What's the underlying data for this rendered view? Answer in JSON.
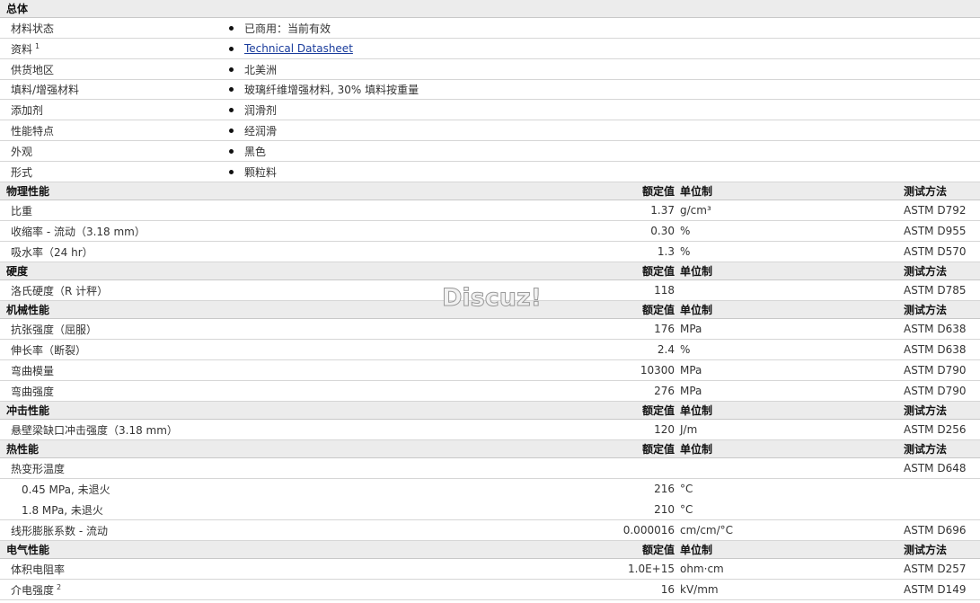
{
  "columns": {
    "nominal": "额定值",
    "unit": "单位制",
    "method": "测试方法"
  },
  "general": {
    "title": "总体",
    "rows": [
      {
        "label": "材料状态",
        "value": "已商用：当前有效"
      },
      {
        "label": "资料",
        "sup": "1",
        "value": "Technical Datasheet"
      },
      {
        "label": "供货地区",
        "value": "北美洲"
      },
      {
        "label": "填料/增强材料",
        "value": "玻璃纤维增强材料, 30% 填料按重量"
      },
      {
        "label": "添加剂",
        "value": "润滑剂"
      },
      {
        "label": "性能特点",
        "value": "经润滑"
      },
      {
        "label": "外观",
        "value": "黑色"
      },
      {
        "label": "形式",
        "value": "颗粒料"
      }
    ]
  },
  "physical": {
    "title": "物理性能",
    "rows": [
      {
        "label": "比重",
        "value": "1.37",
        "unit": "g/cm³",
        "method": "ASTM D792"
      },
      {
        "label": "收缩率  - 流动（3.18 mm）",
        "value": "0.30",
        "unit": "%",
        "method": "ASTM D955"
      },
      {
        "label": "吸水率（24 hr）",
        "value": "1.3",
        "unit": "%",
        "method": "ASTM D570"
      }
    ]
  },
  "hardness": {
    "title": "硬度",
    "rows": [
      {
        "label": "洛氏硬度（R 计秤）",
        "value": "118",
        "unit": "",
        "method": "ASTM D785"
      }
    ]
  },
  "mechanical": {
    "title": "机械性能",
    "rows": [
      {
        "label": "抗张强度（屈服）",
        "value": "176",
        "unit": "MPa",
        "method": "ASTM D638"
      },
      {
        "label": "伸长率（断裂）",
        "value": "2.4",
        "unit": "%",
        "method": "ASTM D638"
      },
      {
        "label": "弯曲模量",
        "value": "10300",
        "unit": "MPa",
        "method": "ASTM D790"
      },
      {
        "label": "弯曲强度",
        "value": "276",
        "unit": "MPa",
        "method": "ASTM D790"
      }
    ]
  },
  "impact": {
    "title": "冲击性能",
    "rows": [
      {
        "label": "悬壁梁缺口冲击强度（3.18 mm）",
        "value": "120",
        "unit": "J/m",
        "method": "ASTM D256"
      }
    ]
  },
  "thermal": {
    "title": "热性能",
    "rows": [
      {
        "label": "热变形温度",
        "value": "",
        "unit": "",
        "method": "ASTM D648"
      },
      {
        "label": "0.45 MPa, 未退火",
        "value": "216",
        "unit": "°C",
        "method": ""
      },
      {
        "label": "1.8 MPa, 未退火",
        "value": "210",
        "unit": "°C",
        "method": ""
      },
      {
        "label": "线形膨胀系数  - 流动",
        "value": "0.000016",
        "unit": "cm/cm/°C",
        "method": "ASTM D696"
      }
    ]
  },
  "electrical": {
    "title": "电气性能",
    "rows": [
      {
        "label": "体积电阻率",
        "value": "1.0E+15",
        "unit": "ohm·cm",
        "method": "ASTM D257"
      },
      {
        "label": "介电强度",
        "sup": "2",
        "value": "16",
        "unit": "kV/mm",
        "method": "ASTM D149"
      }
    ]
  },
  "watermark": "Discuz!"
}
